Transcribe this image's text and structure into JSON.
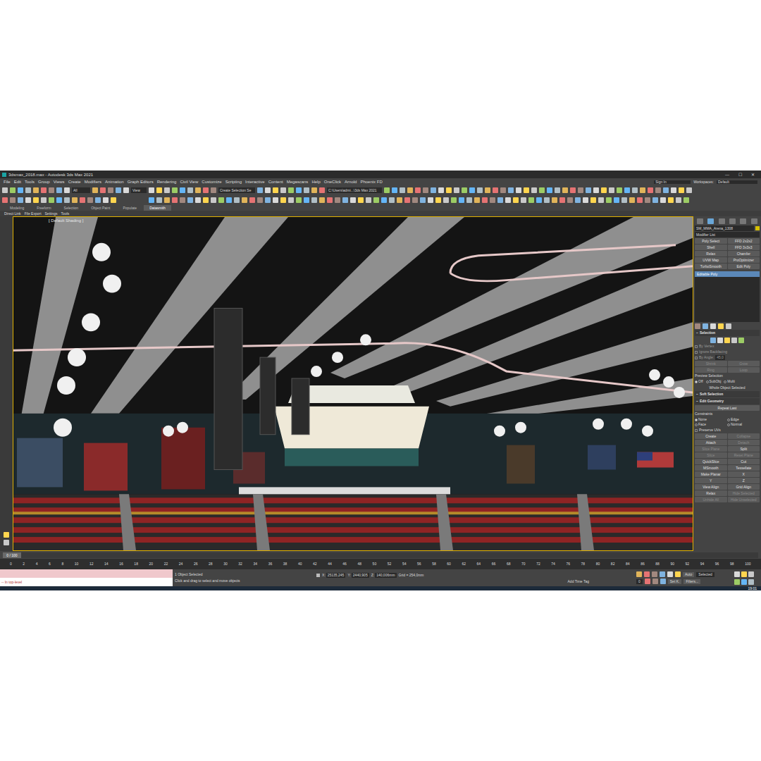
{
  "window": {
    "title": "3dsmax_2018.max - Autodesk 3ds Max 2021",
    "controls": [
      "—",
      "☐",
      "✕"
    ]
  },
  "menu": [
    "File",
    "Edit",
    "Tools",
    "Group",
    "Views",
    "Create",
    "Modifiers",
    "Animation",
    "Graph Editors",
    "Rendering",
    "Civil View",
    "Customize",
    "Scripting",
    "Interactive",
    "Content",
    "Megascans",
    "Help",
    "OneClick",
    "Arnold",
    "Phoenix FD"
  ],
  "account": {
    "sign_in": "Sign In",
    "workspaces_label": "Workspaces:",
    "workspace": "Default"
  },
  "toolbar": {
    "filter": "All",
    "reference": "View",
    "selection_set": "Create Selection Se",
    "project_path": "C:\\Users\\admi...\\3ds Max 2021"
  },
  "ribbon_tabs": [
    {
      "label": "Modeling",
      "selected": false
    },
    {
      "label": "Freeform",
      "selected": false
    },
    {
      "label": "Selection",
      "selected": false
    },
    {
      "label": "Object Paint",
      "selected": false
    },
    {
      "label": "Populate",
      "selected": false
    },
    {
      "label": "Datasmith",
      "selected": true
    }
  ],
  "ribbon_items": [
    "Direct Link",
    "File Export",
    "Settings",
    "Tools"
  ],
  "viewport": {
    "label": "[ Default Shading ]"
  },
  "command_panel": {
    "tabs": [
      {
        "selected": false
      },
      {
        "selected": true
      },
      {
        "selected": false
      },
      {
        "selected": false
      },
      {
        "selected": false
      },
      {
        "selected": false
      }
    ],
    "object_name": "SM_MMA_Arena_1308",
    "modifier_list": "Modifier List",
    "modifier_buttons": [
      "Poly Select",
      "FFD 2x2x2",
      "Shell",
      "FFD 3x3x3",
      "Relax",
      "Chamfer",
      "UVW Map",
      "ProOptimizer",
      "TurboSmooth",
      "Edit Poly"
    ],
    "stack": [
      {
        "label": "Editable Poly",
        "selected": true
      }
    ],
    "selection": {
      "title": "Selection",
      "checks": [
        {
          "label": "By Vertex",
          "checked": false
        },
        {
          "label": "Ignore Backfacing",
          "checked": false
        },
        {
          "label": "By Angle:",
          "checked": false
        }
      ],
      "angle": "45,0",
      "buttons": [
        {
          "label": "Shrink",
          "disabled": true
        },
        {
          "label": "Grow",
          "disabled": true
        },
        {
          "label": "Ring",
          "disabled": true
        },
        {
          "label": "Loop",
          "disabled": true
        }
      ],
      "preview_label": "Preview Selection",
      "preview": [
        {
          "label": "Off",
          "selected": true
        },
        {
          "label": "SubObj",
          "selected": false
        },
        {
          "label": "Multi",
          "selected": false
        }
      ],
      "status": "Whole Object Selected"
    },
    "soft_selection": {
      "title": "Soft Selection"
    },
    "edit_geometry": {
      "title": "Edit Geometry",
      "repeat": "Repeat Last",
      "constraints_label": "Constraints",
      "constraints": [
        {
          "label": "None",
          "selected": true
        },
        {
          "label": "Edge",
          "selected": false
        },
        {
          "label": "Face",
          "selected": false
        },
        {
          "label": "Normal",
          "selected": false
        }
      ],
      "preserve_uvs": {
        "label": "Preserve UVs",
        "checked": false
      },
      "buttons": [
        {
          "label": "Create",
          "disabled": false
        },
        {
          "label": "Collapse",
          "disabled": true
        },
        {
          "label": "Attach",
          "disabled": false
        },
        {
          "label": "Detach",
          "disabled": true
        },
        {
          "label": "Slice Plane",
          "disabled": true
        },
        {
          "label": "Split",
          "disabled": false
        },
        {
          "label": "Slice",
          "disabled": true
        },
        {
          "label": "Reset Plane",
          "disabled": true
        },
        {
          "label": "QuickSlice",
          "disabled": false
        },
        {
          "label": "Cut",
          "disabled": false
        },
        {
          "label": "MSmooth",
          "disabled": false
        },
        {
          "label": "Tessellate",
          "disabled": false
        },
        {
          "label": "Make Planar",
          "disabled": false
        },
        {
          "label": "X",
          "disabled": false
        },
        {
          "label": "Y",
          "disabled": false
        },
        {
          "label": "Z",
          "disabled": false
        },
        {
          "label": "View Align",
          "disabled": false
        },
        {
          "label": "Grid Align",
          "disabled": false
        },
        {
          "label": "Relax",
          "disabled": false
        },
        {
          "label": "Hide Selected",
          "disabled": true
        },
        {
          "label": "Unhide All",
          "disabled": true
        },
        {
          "label": "Hide Unselected",
          "disabled": true
        }
      ]
    }
  },
  "timeline": {
    "frame": "0 / 100",
    "level": 0,
    "ticks": [
      "0",
      "2",
      "4",
      "6",
      "8",
      "10",
      "12",
      "14",
      "16",
      "18",
      "20",
      "22",
      "24",
      "26",
      "28",
      "30",
      "32",
      "34",
      "36",
      "38",
      "40",
      "42",
      "44",
      "46",
      "48",
      "50",
      "52",
      "54",
      "56",
      "58",
      "60",
      "62",
      "64",
      "66",
      "68",
      "70",
      "72",
      "74",
      "76",
      "78",
      "80",
      "82",
      "84",
      "86",
      "88",
      "90",
      "92",
      "94",
      "96",
      "98",
      "100"
    ]
  },
  "status_bar": {
    "listener": "-- In top-level",
    "selection": "1 Object Selected",
    "prompt": "Click and drag to select and move objects",
    "coords": [
      {
        "axis": "X:",
        "value": "25135,245"
      },
      {
        "axis": "Y:",
        "value": "2440,905"
      },
      {
        "axis": "Z:",
        "value": "140,006mm"
      }
    ],
    "grid": "Grid = 254,0mm",
    "time_tag": "Add Time Tag",
    "auto_key": "Auto",
    "key_mode": "Selected",
    "set_key": "Set K.",
    "filters": "Filters...",
    "frame": "0"
  },
  "taskbar": {
    "time": "19:01"
  }
}
